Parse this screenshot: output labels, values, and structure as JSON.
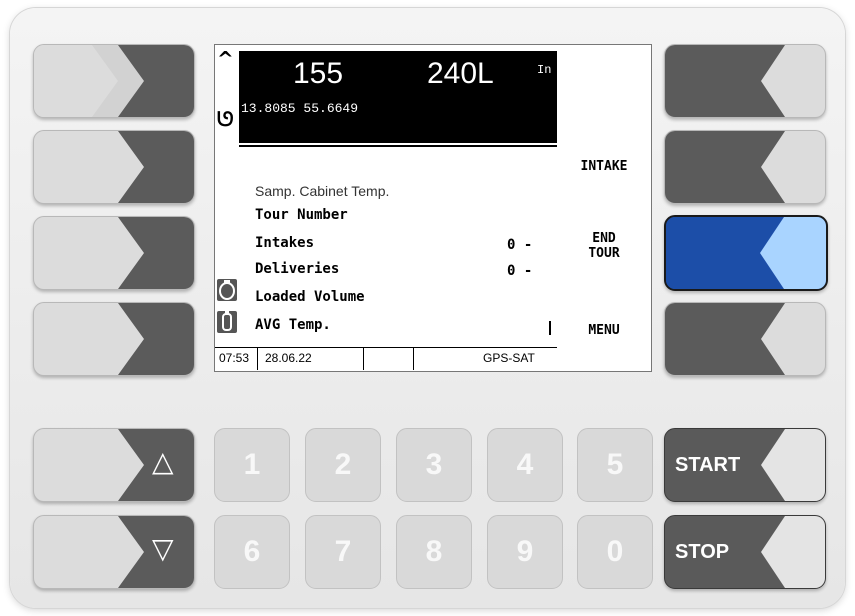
{
  "screen": {
    "top": {
      "value1": "155",
      "value2": "240L",
      "value3": "In",
      "coords": "13.8085  55.6649",
      "up_chevron": "^",
      "down_chevron": "ᘎ"
    },
    "rows": {
      "samp_cabinet": "Samp. Cabinet Temp.",
      "tour_number": "Tour Number",
      "intakes": "Intakes",
      "deliveries": "Deliveries",
      "loaded_volume": "Loaded Volume",
      "avg_temp": "AVG Temp."
    },
    "values": {
      "intakes_val": "0 -",
      "deliveries_val": "0 -"
    },
    "status": {
      "time": "07:53",
      "date": "28.06.22",
      "gps": "GPS-SAT"
    },
    "menu": {
      "intake": "INTAKE",
      "end_tour_1": "END",
      "end_tour_2": "TOUR",
      "menu": "MENU"
    }
  },
  "keypad": {
    "digits": [
      "1",
      "2",
      "3",
      "4",
      "5",
      "6",
      "7",
      "8",
      "9",
      "0"
    ],
    "start_label": "START",
    "stop_label": "STOP",
    "up_symbol": "△",
    "down_symbol": "▽"
  },
  "colors": {
    "active_softkey": "#1c4ea8",
    "active_tab": "#a9d4ff",
    "function_key": "#5a5a5a"
  }
}
